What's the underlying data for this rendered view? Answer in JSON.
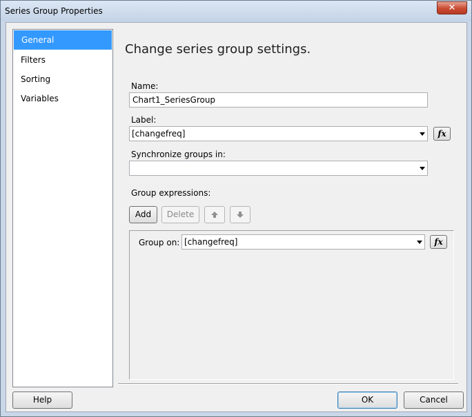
{
  "window": {
    "title": "Series Group Properties",
    "close_glyph": "✕"
  },
  "nav": {
    "items": [
      {
        "label": "General",
        "selected": true
      },
      {
        "label": "Filters",
        "selected": false
      },
      {
        "label": "Sorting",
        "selected": false
      },
      {
        "label": "Variables",
        "selected": false
      }
    ]
  },
  "main": {
    "heading": "Change series group settings.",
    "name_label": "Name:",
    "name_value": "Chart1_SeriesGroup",
    "label_label": "Label:",
    "label_value": "[changefreq]",
    "sync_label": "Synchronize groups in:",
    "sync_value": "",
    "expr_label": "Group expressions:",
    "add_label": "Add",
    "delete_label": "Delete",
    "group_on_label": "Group on:",
    "group_on_value": "[changefreq]",
    "fx_glyph": "fx"
  },
  "footer": {
    "help_label": "Help",
    "ok_label": "OK",
    "cancel_label": "Cancel"
  },
  "colors": {
    "selection": "#3399ff",
    "close_button": "#c84a31",
    "dialog_bg": "#f0f0f0"
  },
  "icons": {
    "move_up": "arrow-up-icon",
    "move_down": "arrow-down-icon",
    "expression": "function-fx-icon"
  }
}
